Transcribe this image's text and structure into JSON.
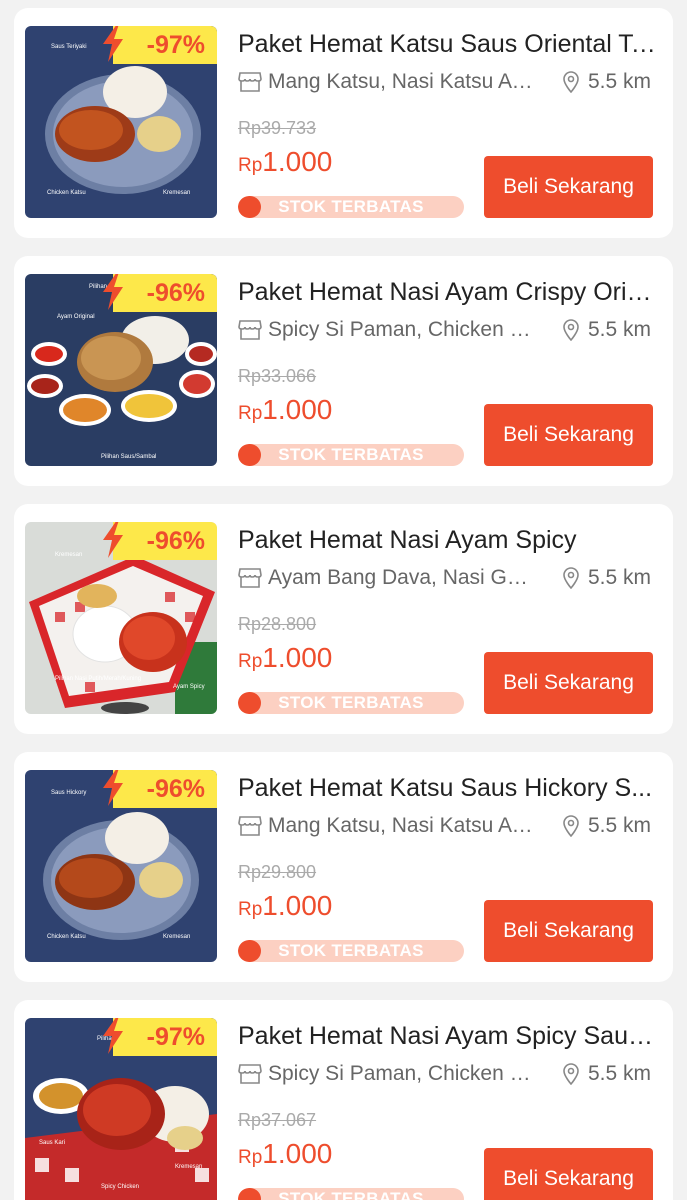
{
  "colors": {
    "accent": "#ee4d2d",
    "badge_bg": "#fde84a",
    "stock_track": "#fcd0c2"
  },
  "products": [
    {
      "discount": "-97%",
      "title": "Paket Hemat Katsu Saus Oriental Te...",
      "merchant": "Mang Katsu, Nasi Katsu Ay...",
      "distance": "5.5 km",
      "old_price": "Rp39.733",
      "currency": "Rp",
      "price": "1.000",
      "stock_label": "STOK TERBATAS",
      "stock_level": 0.1,
      "button": "Beli Sekarang",
      "image_labels": [
        "Saus Teriyaki",
        "Chicken Katsu",
        "Kremesan"
      ]
    },
    {
      "discount": "-96%",
      "title": "Paket Hemat Nasi Ayam Crispy Origi...",
      "merchant": "Spicy Si Paman, Chicken & ...",
      "distance": "5.5 km",
      "old_price": "Rp33.066",
      "currency": "Rp",
      "price": "1.000",
      "stock_label": "STOK TERBATAS",
      "stock_level": 0.1,
      "button": "Beli Sekarang",
      "image_labels": [
        "Pilihan Nasi Putih/Merah/",
        "Ayam Original",
        "Pilihan Saus/Sambal"
      ]
    },
    {
      "discount": "-96%",
      "title": "Paket Hemat Nasi Ayam Spicy",
      "merchant": "Ayam Bang Dava, Nasi Gep...",
      "distance": "5.5 km",
      "old_price": "Rp28.800",
      "currency": "Rp",
      "price": "1.000",
      "stock_label": "STOK TERBATAS",
      "stock_level": 0.1,
      "button": "Beli Sekarang",
      "image_labels": [
        "Kremesan",
        "Pilihan Nasi Putih/Merah/Kuning",
        "Ayam Spicy"
      ]
    },
    {
      "discount": "-96%",
      "title": "Paket Hemat Katsu Saus Hickory S...",
      "merchant": "Mang Katsu, Nasi Katsu Ay...",
      "distance": "5.5 km",
      "old_price": "Rp29.800",
      "currency": "Rp",
      "price": "1.000",
      "stock_label": "STOK TERBATAS",
      "stock_level": 0.1,
      "button": "Beli Sekarang",
      "image_labels": [
        "Saus Hickory",
        "Chicken Katsu",
        "Kremesan"
      ]
    },
    {
      "discount": "-97%",
      "title": "Paket Hemat Nasi Ayam Spicy Saus ...",
      "merchant": "Spicy Si Paman, Chicken & ...",
      "distance": "5.5 km",
      "old_price": "Rp37.067",
      "currency": "Rp",
      "price": "1.000",
      "stock_label": "STOK TERBATAS",
      "stock_level": 0.1,
      "button": "Beli Sekarang",
      "image_labels": [
        "Pilihan Nasi Putih/Merah/",
        "Saus Kari",
        "Spicy Chicken",
        "Kremesan"
      ]
    }
  ]
}
